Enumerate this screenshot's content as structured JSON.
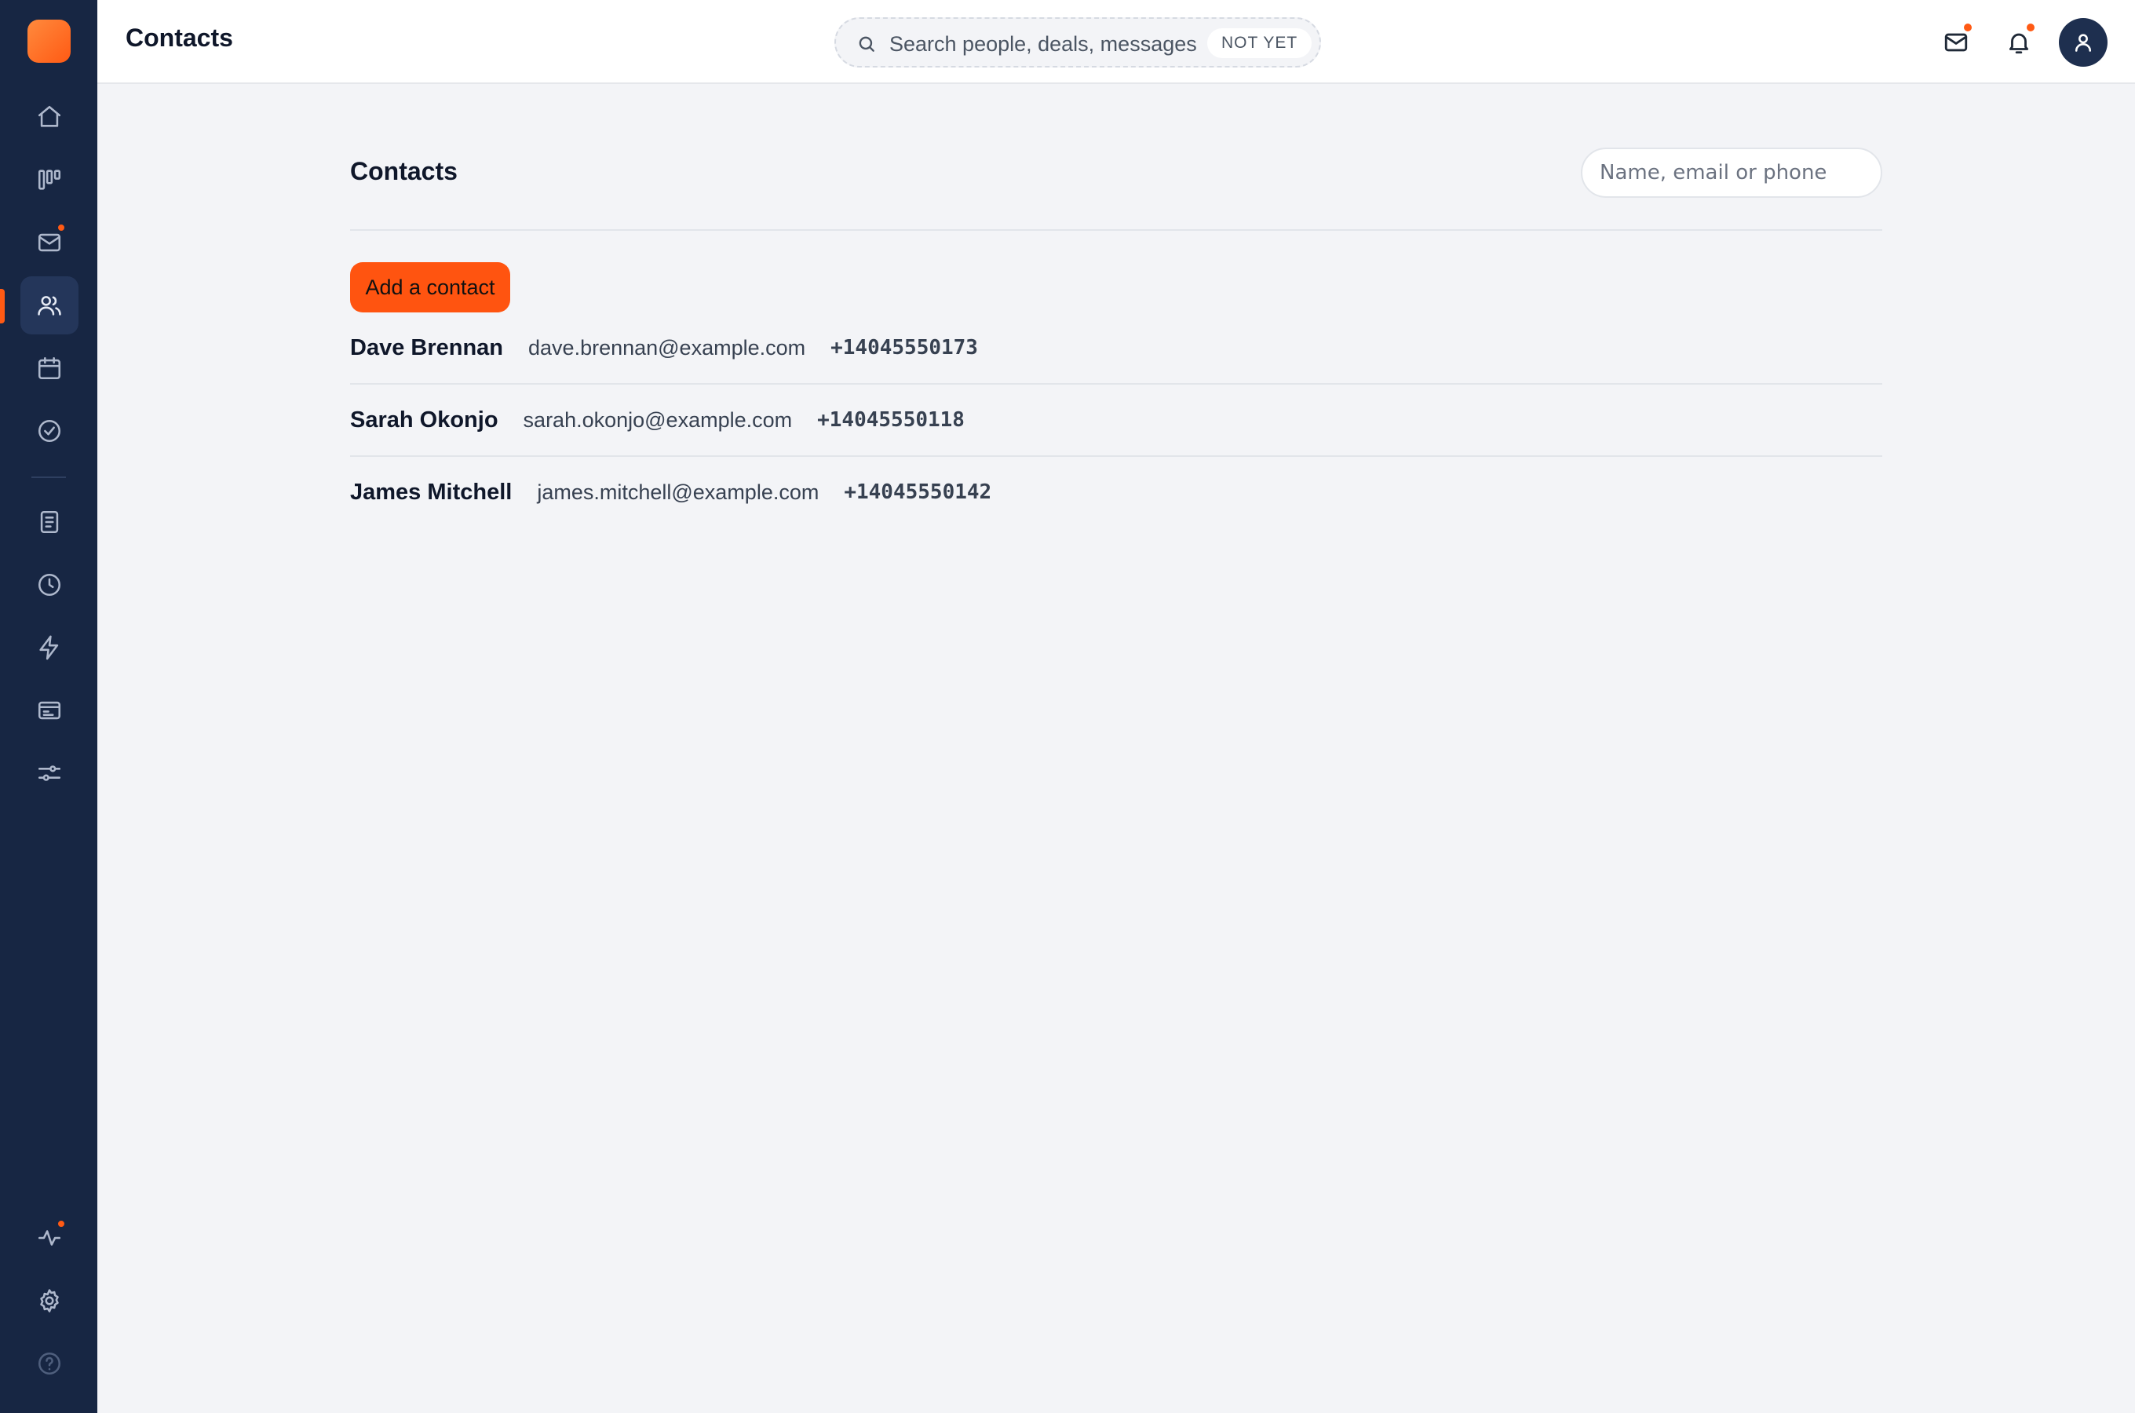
{
  "topbar": {
    "title": "Contacts",
    "search_placeholder": "Search people, deals, messages",
    "search_badge": "NOT YET",
    "icons": [
      "mail-icon",
      "bell-icon",
      "user-avatar-icon"
    ]
  },
  "sidebar": {
    "items": [
      {
        "name": "home",
        "icon": "home-icon"
      },
      {
        "name": "pipeline",
        "icon": "kanban-icon"
      },
      {
        "name": "inbox",
        "icon": "mail-icon",
        "has_notification": true
      },
      {
        "name": "contacts",
        "icon": "users-icon",
        "active": true
      },
      {
        "name": "calendar",
        "icon": "calendar-icon"
      },
      {
        "name": "tasks",
        "icon": "check-circle-icon"
      },
      {
        "name": "documents",
        "icon": "document-icon"
      },
      {
        "name": "history",
        "icon": "clock-icon"
      },
      {
        "name": "automations",
        "icon": "lightning-icon"
      },
      {
        "name": "billing",
        "icon": "card-icon"
      },
      {
        "name": "filters",
        "icon": "sliders-icon"
      },
      {
        "name": "activity",
        "icon": "activity-icon",
        "has_notification": true
      },
      {
        "name": "settings",
        "icon": "gear-icon"
      },
      {
        "name": "help",
        "icon": "help-icon"
      }
    ]
  },
  "main": {
    "title": "Contacts",
    "search_placeholder": "Name, email or phone",
    "add_button": "Add a contact",
    "contacts": [
      {
        "name": "Dave Brennan",
        "email": "dave.brennan@example.com",
        "phone": "+14045550173"
      },
      {
        "name": "Sarah Okonjo",
        "email": "sarah.okonjo@example.com",
        "phone": "+14045550118"
      },
      {
        "name": "James Mitchell",
        "email": "james.mitchell@example.com",
        "phone": "+14045550142"
      }
    ]
  },
  "colors": {
    "accent": "#ff5410",
    "sidebar": "#172643",
    "background": "#f3f4f7"
  }
}
